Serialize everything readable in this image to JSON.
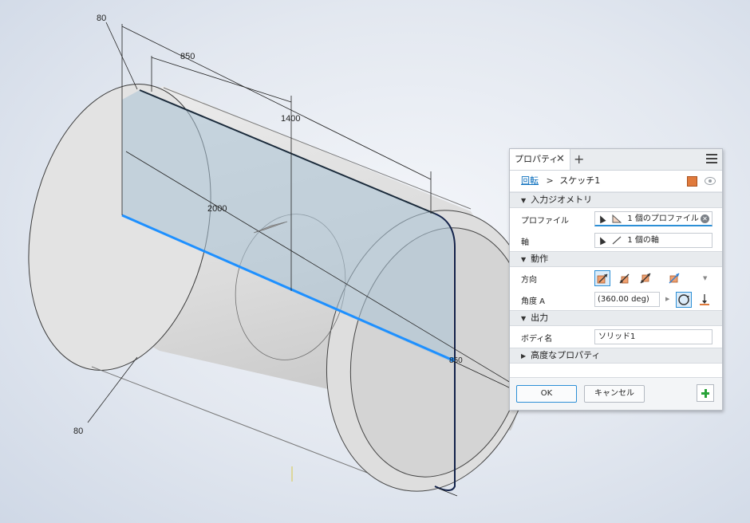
{
  "viewport": {
    "dimensions": [
      "80",
      "850",
      "1400",
      "2000",
      "80",
      "850"
    ]
  },
  "panel": {
    "tab_title": "プロパティ",
    "tab_close": "✕",
    "tab_add": "+",
    "breadcrumb": {
      "feature": "回転",
      "separator": ">",
      "sketch": "スケッチ1"
    },
    "sections": {
      "input_geometry": "入力ジオメトリ",
      "behavior": "動作",
      "output": "出力",
      "advanced": "高度なプロパティ"
    },
    "profile": {
      "label": "プロファイル",
      "value": "1 個のプロファイル"
    },
    "axis": {
      "label": "軸",
      "value": "1 個の軸"
    },
    "direction": {
      "label": "方向"
    },
    "angle": {
      "label": "角度 A",
      "value": "(360.00 deg)"
    },
    "body_name": {
      "label": "ボディ名",
      "value": "ソリッド1"
    },
    "buttons": {
      "ok": "OK",
      "cancel": "キャンセル"
    },
    "colors": {
      "accent": "#2c8fd6",
      "axis_line": "#1e90ff",
      "add": "#2aa33a"
    }
  }
}
